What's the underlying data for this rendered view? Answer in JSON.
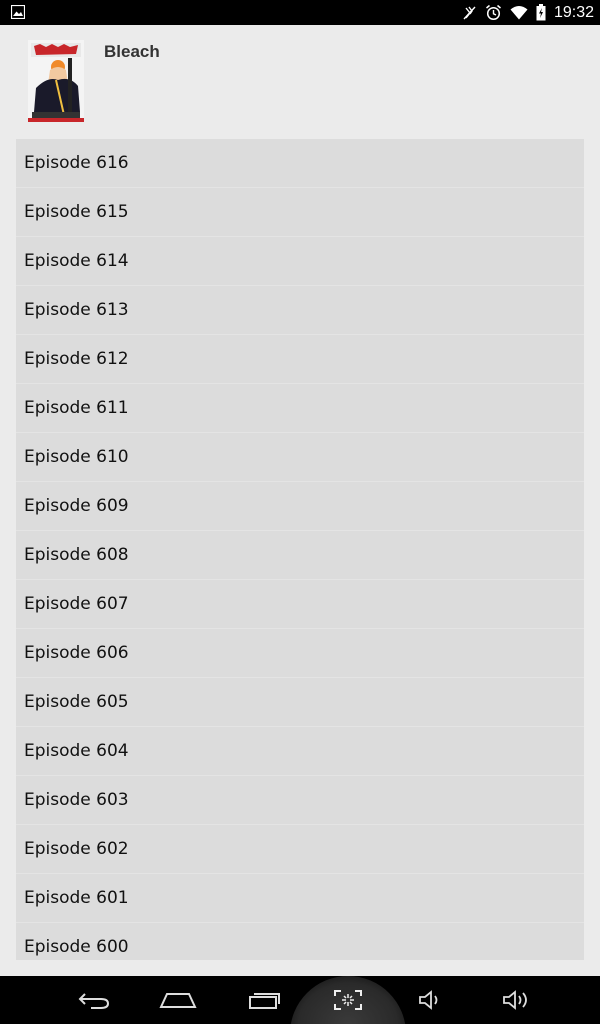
{
  "status_bar": {
    "time": "19:32",
    "icons": [
      "image-notification-icon",
      "mute-icon",
      "alarm-icon",
      "wifi-icon",
      "battery-icon"
    ]
  },
  "series": {
    "title": "Bleach",
    "cover_icon": "manga-cover-image"
  },
  "episodes": [
    "Episode 616",
    "Episode 615",
    "Episode 614",
    "Episode 613",
    "Episode 612",
    "Episode 611",
    "Episode 610",
    "Episode 609",
    "Episode 608",
    "Episode 607",
    "Episode 606",
    "Episode 605",
    "Episode 604",
    "Episode 603",
    "Episode 602",
    "Episode 601",
    "Episode 600"
  ],
  "nav_bar": {
    "buttons": [
      "back-icon",
      "home-icon",
      "recents-icon",
      "screenshot-icon",
      "volume-down-icon",
      "volume-up-icon"
    ]
  },
  "colors": {
    "background": "#ebebeb",
    "list_background": "#dcdcdc",
    "bar_background": "#000000"
  }
}
